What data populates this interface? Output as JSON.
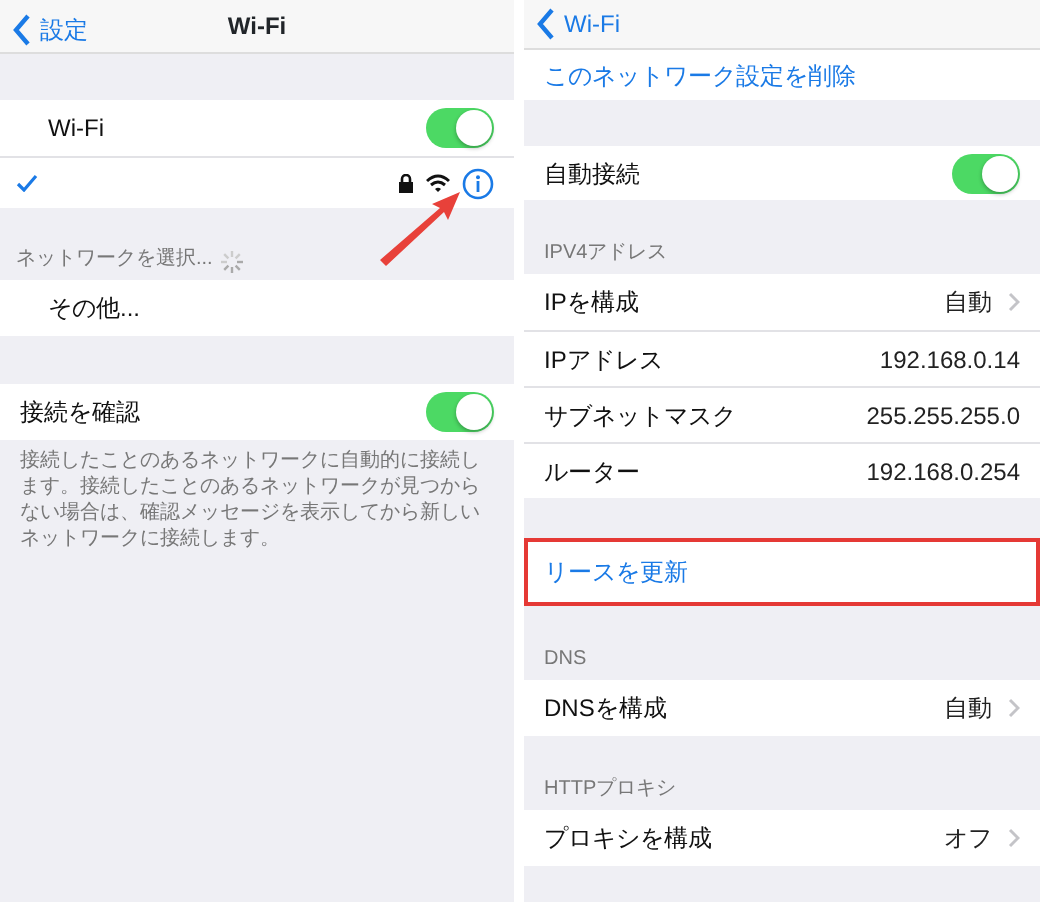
{
  "left": {
    "nav": {
      "back": "設定",
      "title": "Wi-Fi"
    },
    "wifi_row": {
      "label": "Wi-Fi",
      "on": true
    },
    "network_row": {
      "selected": true,
      "locked": true,
      "pointer_arrow": true
    },
    "section_header": "ネットワークを選択...",
    "other_row": {
      "label": "その他..."
    },
    "ask_row": {
      "label": "接続を確認",
      "on": true
    },
    "ask_footer": "接続したことのあるネットワークに自動的に接続します。接続したことのあるネットワークが見つからない場合は、確認メッセージを表示してから新しいネットワークに接続します。"
  },
  "right": {
    "nav": {
      "back": "Wi-Fi"
    },
    "forget": "このネットワーク設定を削除",
    "auto_join": {
      "label": "自動接続",
      "on": true
    },
    "groups": [
      {
        "header": "IPV4アドレス",
        "rows": [
          {
            "kind": "link",
            "label": "IPを構成",
            "value": "自動"
          },
          {
            "kind": "info",
            "label": "IPアドレス",
            "value": "192.168.0.14"
          },
          {
            "kind": "info",
            "label": "サブネットマスク",
            "value": "255.255.255.0"
          },
          {
            "kind": "info",
            "label": "ルーター",
            "value": "192.168.0.254"
          }
        ]
      },
      {
        "rows": [
          {
            "kind": "action",
            "label": "リースを更新",
            "highlighted": true
          }
        ]
      },
      {
        "header": "DNS",
        "rows": [
          {
            "kind": "link",
            "label": "DNSを構成",
            "value": "自動"
          }
        ]
      },
      {
        "header": "HTTPプロキシ",
        "rows": [
          {
            "kind": "link",
            "label": "プロキシを構成",
            "value": "オフ"
          }
        ]
      }
    ]
  }
}
